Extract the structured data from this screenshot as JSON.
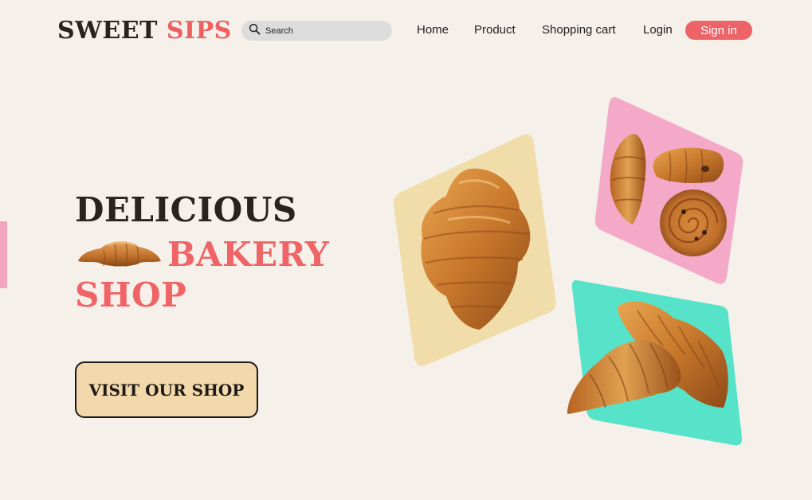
{
  "header": {
    "logo_part1": "SWEET",
    "logo_part2": "SIPS",
    "search_placeholder": "Search",
    "nav": {
      "home": "Home",
      "product": "Product",
      "cart": "Shopping cart",
      "login": "Login",
      "signin": "Sign in"
    }
  },
  "hero": {
    "line1": "DELICIOUS",
    "line2": "BAKERY",
    "line3": "SHOP",
    "cta_label": "VISIT OUR SHOP"
  },
  "colors": {
    "background": "#f5f0ea",
    "accent_red": "#ef5f5f",
    "tile_yellow": "#f0dda9",
    "tile_pink": "#f4a9c8",
    "tile_teal": "#57e3c9",
    "cta_fill": "#f2d8ab"
  },
  "icons": {
    "search": "search-icon",
    "hero_croissant": "croissant-icon"
  }
}
